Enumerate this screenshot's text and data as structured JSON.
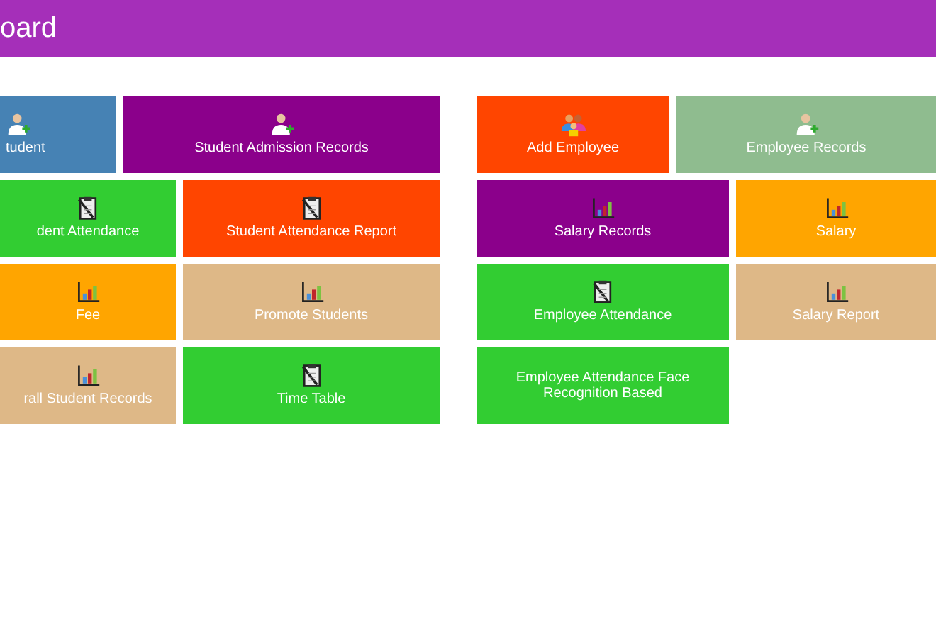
{
  "header": {
    "title": "oard"
  },
  "groups": [
    {
      "rows": [
        [
          {
            "label": "tudent",
            "color": "#4682b4",
            "kind": "enroll"
          },
          {
            "label": "Student Admission Records",
            "color": "#8b008b",
            "kind": "enroll"
          }
        ],
        [
          {
            "label": "dent Attendance",
            "color": "#32cd32",
            "kind": "attendance"
          },
          {
            "label": "Student Attendance Report",
            "color": "#ff4500",
            "kind": "attendance"
          }
        ],
        [
          {
            "label": "Fee",
            "color": "#ffa500",
            "kind": "report"
          },
          {
            "label": "Promote Students",
            "color": "#deb887",
            "kind": "report"
          }
        ],
        [
          {
            "label": "rall Student Records",
            "color": "#deb887",
            "kind": "report"
          },
          {
            "label": "Time Table",
            "color": "#32cd32",
            "kind": "attendance"
          }
        ]
      ]
    },
    {
      "rows": [
        [
          {
            "label": "Add Employee",
            "color": "#ff4500",
            "kind": "team"
          },
          {
            "label": "Employee Records",
            "color": "#8fbc8f",
            "kind": "enroll"
          }
        ],
        [
          {
            "label": "Salary Records",
            "color": "#8b008b",
            "kind": "report"
          },
          {
            "label": "Salary",
            "color": "#ffa500",
            "kind": "report"
          }
        ],
        [
          {
            "label": "Employee Attendance",
            "color": "#32cd32",
            "kind": "attendance"
          },
          {
            "label": "Salary Report",
            "color": "#deb887",
            "kind": "report"
          }
        ],
        [
          {
            "label": "Employee Attendance Face Recognition Based",
            "color": "#32cd32",
            "kind": "plain"
          }
        ]
      ]
    }
  ]
}
